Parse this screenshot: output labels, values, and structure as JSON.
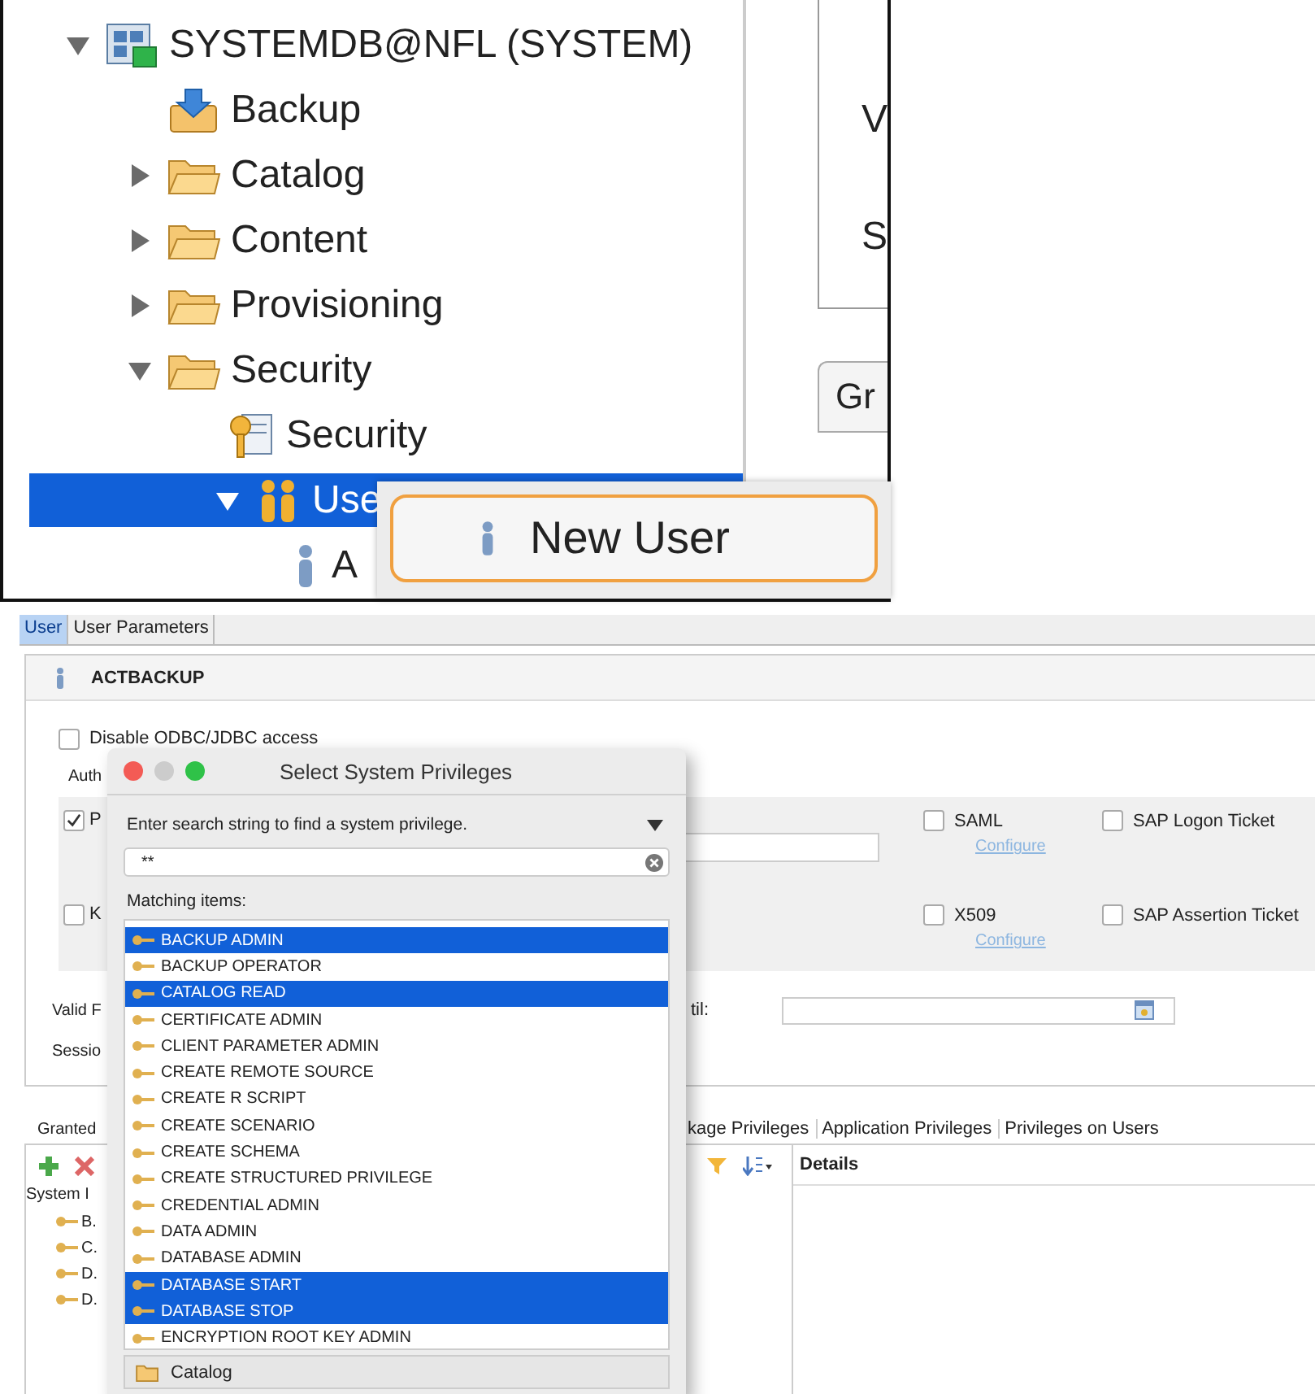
{
  "tree_panel": {
    "root": {
      "label": "SYSTEMDB@NFL (SYSTEM)",
      "kind": "system",
      "expanded": true,
      "selected": false,
      "children": [
        {
          "label": "Backup",
          "kind": "backup",
          "selected": false
        },
        {
          "label": "Catalog",
          "kind": "folder",
          "expanded": false,
          "selected": false
        },
        {
          "label": "Content",
          "kind": "folder",
          "expanded": false,
          "selected": false
        },
        {
          "label": "Provisioning",
          "kind": "folder",
          "expanded": false,
          "selected": false
        },
        {
          "label": "Security",
          "kind": "folder",
          "expanded": true,
          "selected": false,
          "children": [
            {
              "label": "Security",
              "kind": "security",
              "selected": false
            },
            {
              "label": "Use",
              "kind": "users",
              "expanded": true,
              "selected": true,
              "children": [
                {
                  "label": "A",
                  "kind": "user",
                  "selected": false
                }
              ]
            }
          ]
        }
      ]
    }
  },
  "side_panel": {
    "texts": [
      "V",
      "S"
    ],
    "tab": "Gr"
  },
  "context_menu": {
    "items": [
      {
        "label": "New User",
        "selected": true
      }
    ]
  },
  "editor": {
    "tabs": [
      {
        "label": "User",
        "selected": true
      },
      {
        "label": "User Parameters",
        "selected": false
      }
    ],
    "user_name": "ACTBACKUP",
    "disable_access": {
      "label": "Disable ODBC/JDBC access",
      "checked": false
    },
    "auth_label": "Auth",
    "auth_rows": [
      {
        "label": "P",
        "checked": true,
        "field": true,
        "options": [
          {
            "label": "SAML",
            "checked": false,
            "link": "Configure"
          },
          {
            "label": "SAP Logon Ticket",
            "checked": false
          }
        ]
      },
      {
        "label": "K",
        "checked": false,
        "field": false,
        "options": [
          {
            "label": "X509",
            "checked": false,
            "link": "Configure"
          },
          {
            "label": "SAP Assertion Ticket",
            "checked": false
          }
        ]
      }
    ],
    "valid_from_label": "Valid F",
    "valid_until_label": "til:",
    "session_label": "Sessio",
    "privilege_tabs": [
      "Granted",
      "kage Privileges",
      "Application Privileges",
      "Privileges on Users"
    ],
    "granted_header": "System I",
    "granted_items": [
      "B.",
      "C.",
      "D.",
      "D."
    ],
    "details_title": "Details"
  },
  "dialog": {
    "title": "Select System Privileges",
    "prompt": "Enter search string to find a system privilege.",
    "search_value": "**",
    "matching_label": "Matching items:",
    "items": [
      {
        "label": "BACKUP ADMIN",
        "selected": true
      },
      {
        "label": "BACKUP OPERATOR",
        "selected": false
      },
      {
        "label": "CATALOG READ",
        "selected": true
      },
      {
        "label": "CERTIFICATE ADMIN",
        "selected": false
      },
      {
        "label": "CLIENT PARAMETER ADMIN",
        "selected": false
      },
      {
        "label": "CREATE REMOTE SOURCE",
        "selected": false
      },
      {
        "label": "CREATE R SCRIPT",
        "selected": false
      },
      {
        "label": "CREATE SCENARIO",
        "selected": false
      },
      {
        "label": "CREATE SCHEMA",
        "selected": false
      },
      {
        "label": "CREATE STRUCTURED PRIVILEGE",
        "selected": false
      },
      {
        "label": "CREDENTIAL ADMIN",
        "selected": false
      },
      {
        "label": "DATA ADMIN",
        "selected": false
      },
      {
        "label": "DATABASE ADMIN",
        "selected": false
      },
      {
        "label": "DATABASE START",
        "selected": true
      },
      {
        "label": "DATABASE STOP",
        "selected": true
      },
      {
        "label": "ENCRYPTION ROOT KEY ADMIN",
        "selected": false
      }
    ],
    "footer": "Catalog"
  }
}
